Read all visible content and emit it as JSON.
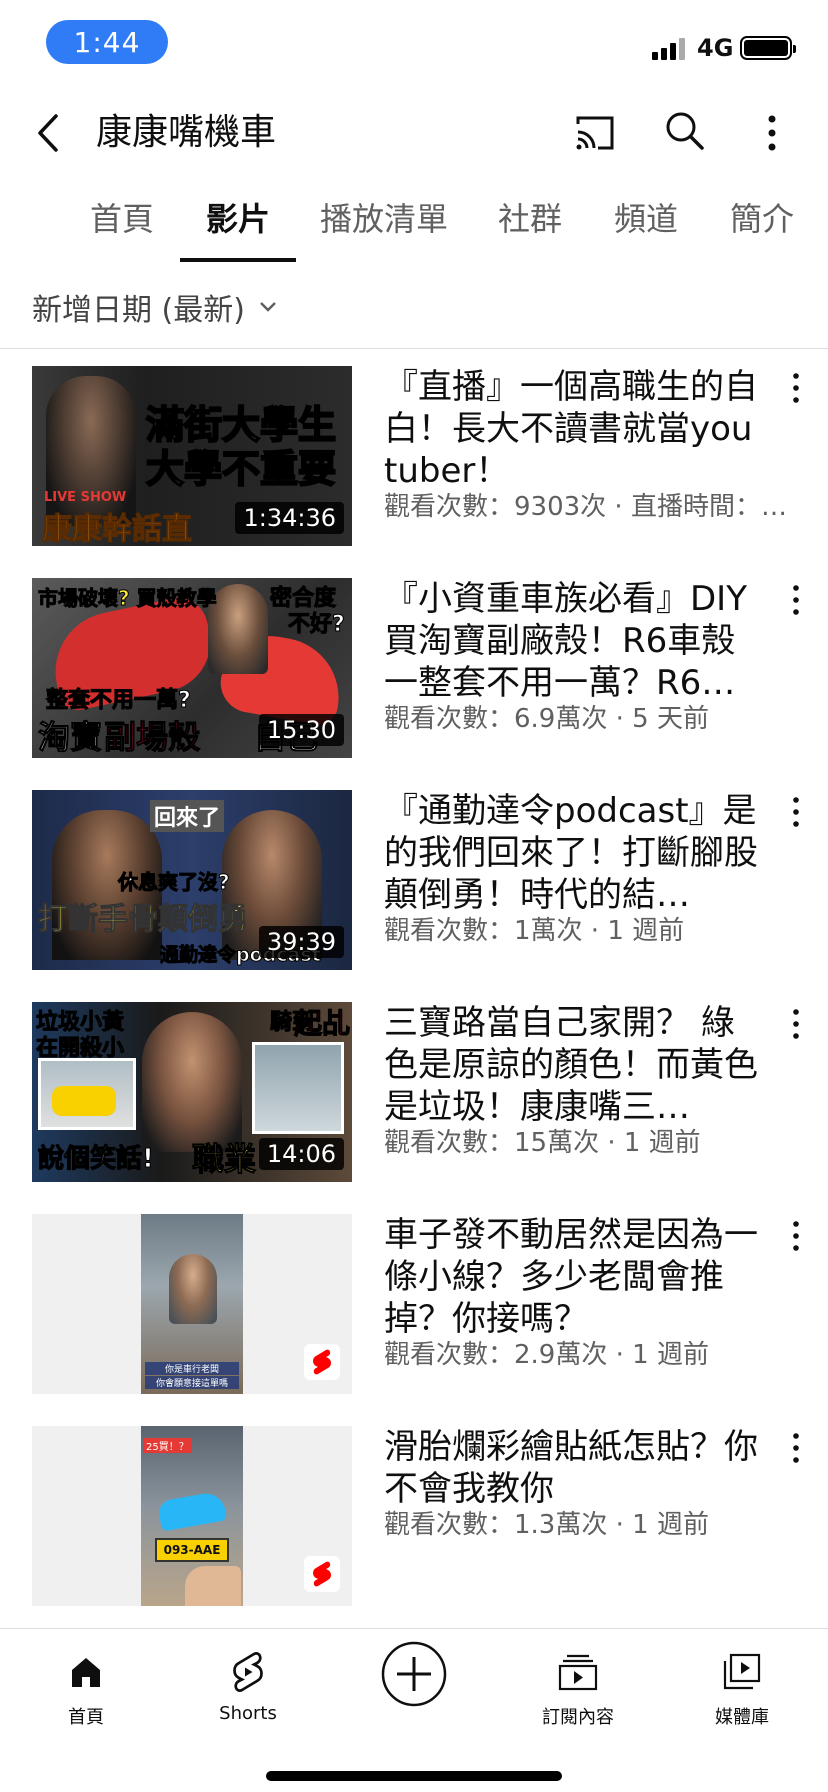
{
  "status": {
    "time": "1:44",
    "network": "4G"
  },
  "header": {
    "channel_name": "康康嘴機車"
  },
  "tabs": [
    {
      "label": "首頁",
      "active": false
    },
    {
      "label": "影片",
      "active": true
    },
    {
      "label": "播放清單",
      "active": false
    },
    {
      "label": "社群",
      "active": false
    },
    {
      "label": "頻道",
      "active": false
    },
    {
      "label": "簡介",
      "active": false
    }
  ],
  "sort": {
    "label": "新增日期 (最新)"
  },
  "videos": [
    {
      "title": "『直播』一個高職生的自白！長大不讀書就當youtuber！",
      "meta": "觀看次數：9303次 · 直播時間：…",
      "duration": "1:34:36",
      "thumb_text": [
        "滿街大學生",
        "大學不重要",
        "康康幹話直"
      ],
      "thumb_tag": "LIVE SHOW"
    },
    {
      "title": "『小資重車族必看』DIY買淘寶副廠殼！R6車殼一整套不用一萬？R6…",
      "meta": "觀看次數：6.9萬次 · 5 天前",
      "duration": "15:30",
      "thumb_text": [
        "市場破壞? 買殼教學",
        "密合度",
        "不好?",
        "整套不用一萬?",
        "淘寶",
        "副場殼",
        "自己買!"
      ]
    },
    {
      "title": "『通勤達令podcast』是的我們回來了！打斷腳股顛倒勇！時代的結…",
      "meta": "觀看次數：1萬次 · 1 週前",
      "duration": "39:39",
      "thumb_text": [
        "回來了",
        "休息爽了沒?",
        "打斷手骨顛倒勇",
        "通勤達令podcast"
      ]
    },
    {
      "title": "三寶路當自己家開？ 綠色是原諒的顏色！而黃色是垃圾！康康嘴三…",
      "meta": "觀看次數：15萬次 · 1 週前",
      "duration": "14:06",
      "thumb_text": [
        "垃圾小黃",
        "在開殺小",
        "騎到",
        "起乩",
        "說個笑話!",
        "職業"
      ]
    },
    {
      "title": "車子發不動居然是因為一條小線？多少老闆會推掉？你接嗎？",
      "meta": "觀看次數：2.9萬次 · 1 週前",
      "thumb_text": [
        "你是車行老闆",
        "你會願意接這單嗎"
      ]
    },
    {
      "title": "滑胎爛彩繪貼紙怎貼？你不會我教你",
      "meta": "觀看次數：1.3萬次 · 1 週前",
      "thumb_text": [
        "25買！？",
        "093-AAE"
      ]
    }
  ],
  "bottom_nav": [
    {
      "label": "首頁",
      "icon": "home-icon"
    },
    {
      "label": "Shorts",
      "icon": "shorts-icon"
    },
    {
      "label": "",
      "icon": "create-icon"
    },
    {
      "label": "訂閱內容",
      "icon": "subscriptions-icon"
    },
    {
      "label": "媒體庫",
      "icon": "library-icon"
    }
  ],
  "colors": {
    "accent": "#2f7cf6",
    "shorts_red": "#ff0000",
    "text_secondary": "#606060"
  }
}
